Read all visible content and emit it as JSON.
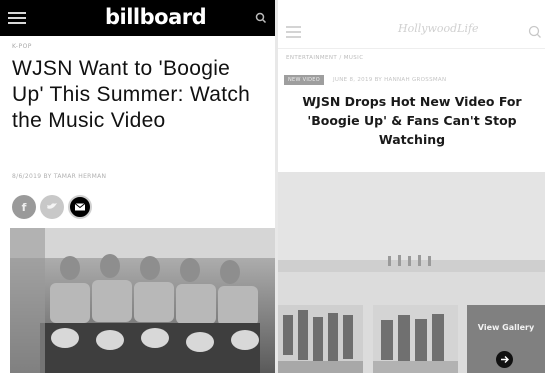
{
  "left": {
    "brand": "billboard",
    "breadcrumb": "K-POP",
    "title": "WJSN Want to 'Boogie Up' This Summer: Watch the Music Video",
    "byline": "8/6/2019 BY TAMAR HERMAN",
    "share": {
      "facebook": "facebook-icon",
      "twitter": "twitter-icon",
      "email": "email-icon"
    }
  },
  "right": {
    "brand": "HollywoodLife",
    "breadcrumb": "ENTERTAINMENT / MUSIC",
    "tag": "NEW VIDEO",
    "date": "JUNE 8, 2019 BY HANNAH GROSSMAN",
    "title": "WJSN Drops Hot New Video For 'Boogie Up' & Fans Can't Stop Watching",
    "gallery_label": "View Gallery"
  },
  "colors": {
    "billboard_header": "#000000",
    "tag_bg": "#9e9e9e",
    "gallery_overlay": "#808080"
  }
}
